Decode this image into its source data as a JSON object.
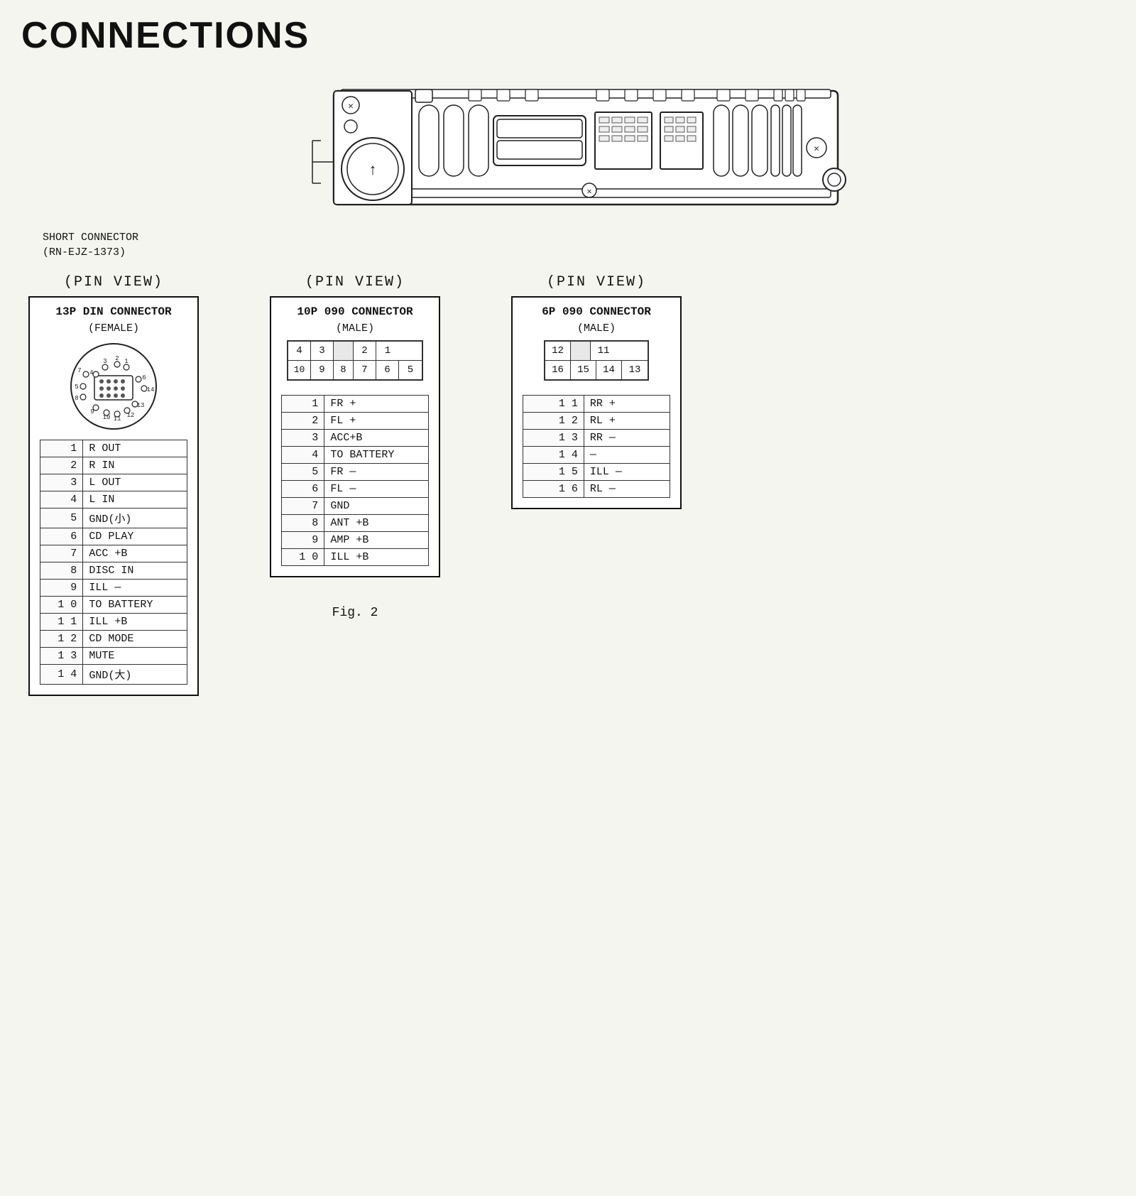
{
  "title": "CONNECTIONS",
  "short_connector_label": "SHORT CONNECTOR\n(RN-EJZ-1373)",
  "fig_label": "Fig. 2",
  "sections": [
    {
      "pin_view": "(PIN  VIEW)",
      "connector_title": "13P DIN CONNECTOR",
      "connector_subtitle": "(FEMALE)",
      "has_circle_diagram": true,
      "pins": [
        {
          "num": "1",
          "signal": "R OUT"
        },
        {
          "num": "2",
          "signal": "R IN"
        },
        {
          "num": "3",
          "signal": "L OUT"
        },
        {
          "num": "4",
          "signal": "L IN"
        },
        {
          "num": "5",
          "signal": "GND(小)"
        },
        {
          "num": "6",
          "signal": "CD PLAY"
        },
        {
          "num": "7",
          "signal": "ACC +B"
        },
        {
          "num": "8",
          "signal": "DISC IN"
        },
        {
          "num": "9",
          "signal": "ILL —"
        },
        {
          "num": "1 0",
          "signal": "TO BATTERY"
        },
        {
          "num": "1 1",
          "signal": "ILL +B"
        },
        {
          "num": "1 2",
          "signal": "CD MODE"
        },
        {
          "num": "1 3",
          "signal": "MUTE"
        },
        {
          "num": "1 4",
          "signal": "GND(大)"
        }
      ]
    },
    {
      "pin_view": "(PIN  VIEW)",
      "connector_title": "10P 090 CONNECTOR",
      "connector_subtitle": "(MALE)",
      "has_grid_diagram": true,
      "grid": [
        [
          "4",
          "3",
          "",
          "2",
          "1"
        ],
        [
          "10",
          "9",
          "8",
          "7",
          "6",
          "5"
        ]
      ],
      "pins": [
        {
          "num": "1",
          "signal": "FR +"
        },
        {
          "num": "2",
          "signal": "FL +"
        },
        {
          "num": "3",
          "signal": "ACC+B"
        },
        {
          "num": "4",
          "signal": "TO BATTERY"
        },
        {
          "num": "5",
          "signal": "FR —"
        },
        {
          "num": "6",
          "signal": "FL —"
        },
        {
          "num": "7",
          "signal": "GND"
        },
        {
          "num": "8",
          "signal": "ANT +B"
        },
        {
          "num": "9",
          "signal": "AMP +B"
        },
        {
          "num": "1 0",
          "signal": "ILL +B"
        }
      ]
    },
    {
      "pin_view": "(PIN  VIEW)",
      "connector_title": "6P 090 CONNECTOR",
      "connector_subtitle": "(MALE)",
      "has_grid_diagram": true,
      "grid": [
        [
          "12",
          "",
          "11"
        ],
        [
          "16",
          "15",
          "14",
          "13"
        ]
      ],
      "pins": [
        {
          "num": "1 1",
          "signal": "RR +"
        },
        {
          "num": "1 2",
          "signal": "RL +"
        },
        {
          "num": "1 3",
          "signal": "RR —"
        },
        {
          "num": "1 4",
          "signal": "—"
        },
        {
          "num": "1 5",
          "signal": "ILL —"
        },
        {
          "num": "1 6",
          "signal": "RL —"
        }
      ]
    }
  ]
}
